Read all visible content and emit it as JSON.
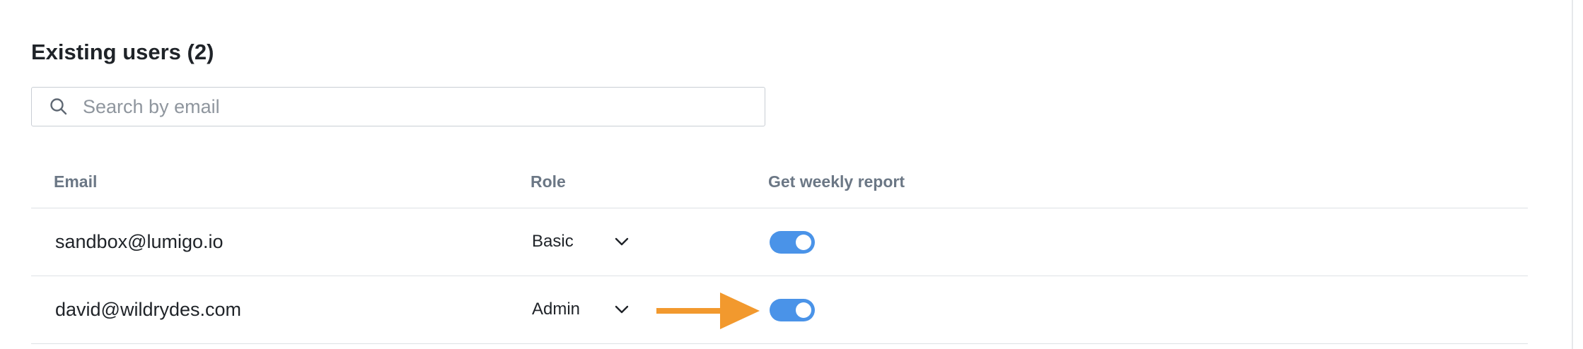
{
  "section": {
    "title": "Existing users (2)"
  },
  "search": {
    "placeholder": "Search by email",
    "value": "",
    "icon": "search-icon"
  },
  "table": {
    "columns": {
      "email": "Email",
      "role": "Role",
      "weekly_report": "Get weekly report"
    },
    "rows": [
      {
        "email": "sandbox@lumigo.io",
        "role": "Basic",
        "weekly_report": true
      },
      {
        "email": "david@wildrydes.com",
        "role": "Admin",
        "weekly_report": true
      }
    ]
  },
  "colors": {
    "toggle_on": "#4a93e8",
    "annotation_arrow": "#f2992e",
    "header_text": "#6b7785",
    "border": "#dde1e5"
  }
}
